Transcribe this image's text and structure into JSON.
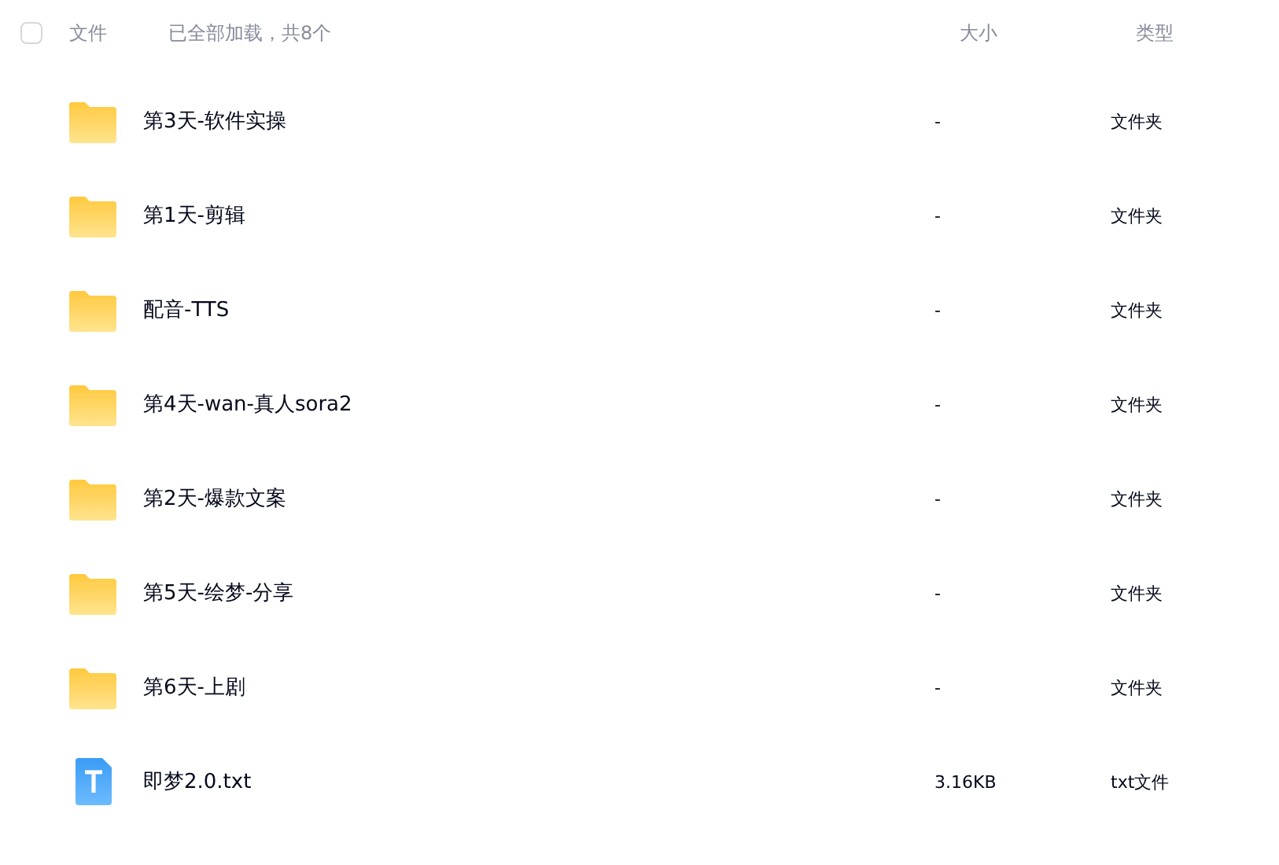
{
  "header": {
    "select_all": {
      "checked": false
    },
    "name_label": "文件",
    "load_status": "已全部加载，共8个",
    "size_label": "大小",
    "type_label": "类型"
  },
  "rows": [
    {
      "kind": "folder",
      "name": "第3天-软件实操",
      "size": "-",
      "type": "文件夹"
    },
    {
      "kind": "folder",
      "name": "第1天-剪辑",
      "size": "-",
      "type": "文件夹"
    },
    {
      "kind": "folder",
      "name": "配音-TTS",
      "size": "-",
      "type": "文件夹"
    },
    {
      "kind": "folder",
      "name": "第4天-wan-真人sora2",
      "size": "-",
      "type": "文件夹"
    },
    {
      "kind": "folder",
      "name": "第2天-爆款文案",
      "size": "-",
      "type": "文件夹"
    },
    {
      "kind": "folder",
      "name": "第5天-绘梦-分享",
      "size": "-",
      "type": "文件夹"
    },
    {
      "kind": "folder",
      "name": "第6天-上剧",
      "size": "-",
      "type": "文件夹"
    },
    {
      "kind": "text",
      "name": "即梦2.0.txt",
      "size": "3.16KB",
      "type": "txt文件"
    }
  ]
}
